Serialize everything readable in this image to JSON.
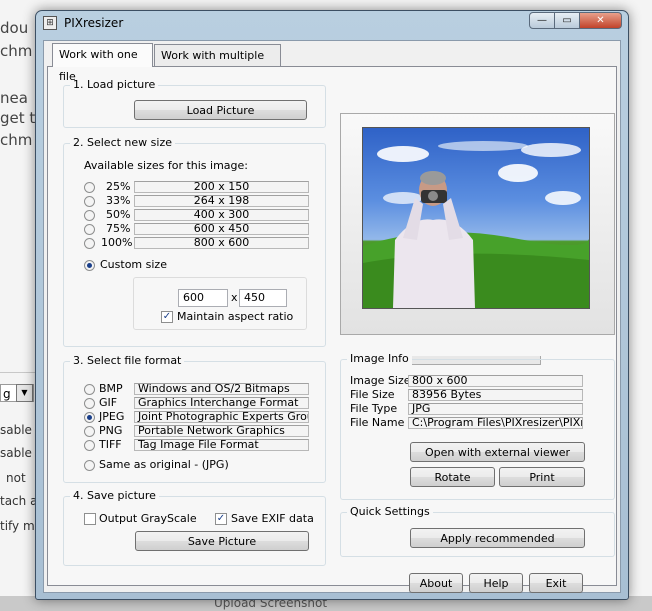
{
  "background": {
    "lines": [
      "dou",
      "chm",
      "nea",
      "get t",
      "chm"
    ],
    "combo_value": "g",
    "side_lines": [
      "sable",
      "sable",
      "not",
      "tach a",
      "tify m"
    ],
    "bottom_text": "Upload Screenshot"
  },
  "window": {
    "title": "PIXresizer",
    "controls": {
      "minimize": "—",
      "maximize": "▭",
      "close": "✕"
    }
  },
  "tabs": [
    {
      "label": "Work with one file",
      "active": true
    },
    {
      "label": "Work with multiple files",
      "active": false
    }
  ],
  "load": {
    "group_label": "1. Load picture",
    "button": "Load Picture"
  },
  "size": {
    "group_label": "2. Select new size",
    "available_label": "Available sizes for this image:",
    "options": [
      {
        "percent": "25%",
        "dims": "200 x 150"
      },
      {
        "percent": "33%",
        "dims": "264 x 198"
      },
      {
        "percent": "50%",
        "dims": "400 x 300"
      },
      {
        "percent": "75%",
        "dims": "600 x 450"
      },
      {
        "percent": "100%",
        "dims": "800 x 600"
      }
    ],
    "custom_label": "Custom size",
    "custom_width": "600",
    "times": "x",
    "custom_height": "450",
    "aspect_label": "Maintain aspect ratio"
  },
  "format": {
    "group_label": "3. Select file format",
    "options": [
      {
        "code": "BMP",
        "desc": "Windows and OS/2 Bitmaps"
      },
      {
        "code": "GIF",
        "desc": "Graphics Interchange Format"
      },
      {
        "code": "JPEG",
        "desc": "Joint Photographic Experts Group"
      },
      {
        "code": "PNG",
        "desc": "Portable Network Graphics"
      },
      {
        "code": "TIFF",
        "desc": "Tag Image File Format"
      }
    ],
    "same_label": "Same as original  - (JPG)"
  },
  "save": {
    "group_label": "4. Save picture",
    "grayscale_label": "Output GrayScale",
    "exif_label": "Save EXIF data",
    "button": "Save Picture"
  },
  "info": {
    "group_label": "Image Info",
    "rows": [
      {
        "label": "Image Size",
        "value": "800 x 600"
      },
      {
        "label": "File Size",
        "value": "83956 Bytes"
      },
      {
        "label": "File Type",
        "value": "JPG"
      },
      {
        "label": "File Name",
        "value": "C:\\Program Files\\PIXresizer\\PIXresiz"
      }
    ],
    "open_button": "Open with external viewer",
    "rotate_button": "Rotate",
    "print_button": "Print"
  },
  "quick": {
    "group_label": "Quick Settings",
    "apply_button": "Apply recommended"
  },
  "footer": {
    "about": "About",
    "help": "Help",
    "exit": "Exit"
  }
}
